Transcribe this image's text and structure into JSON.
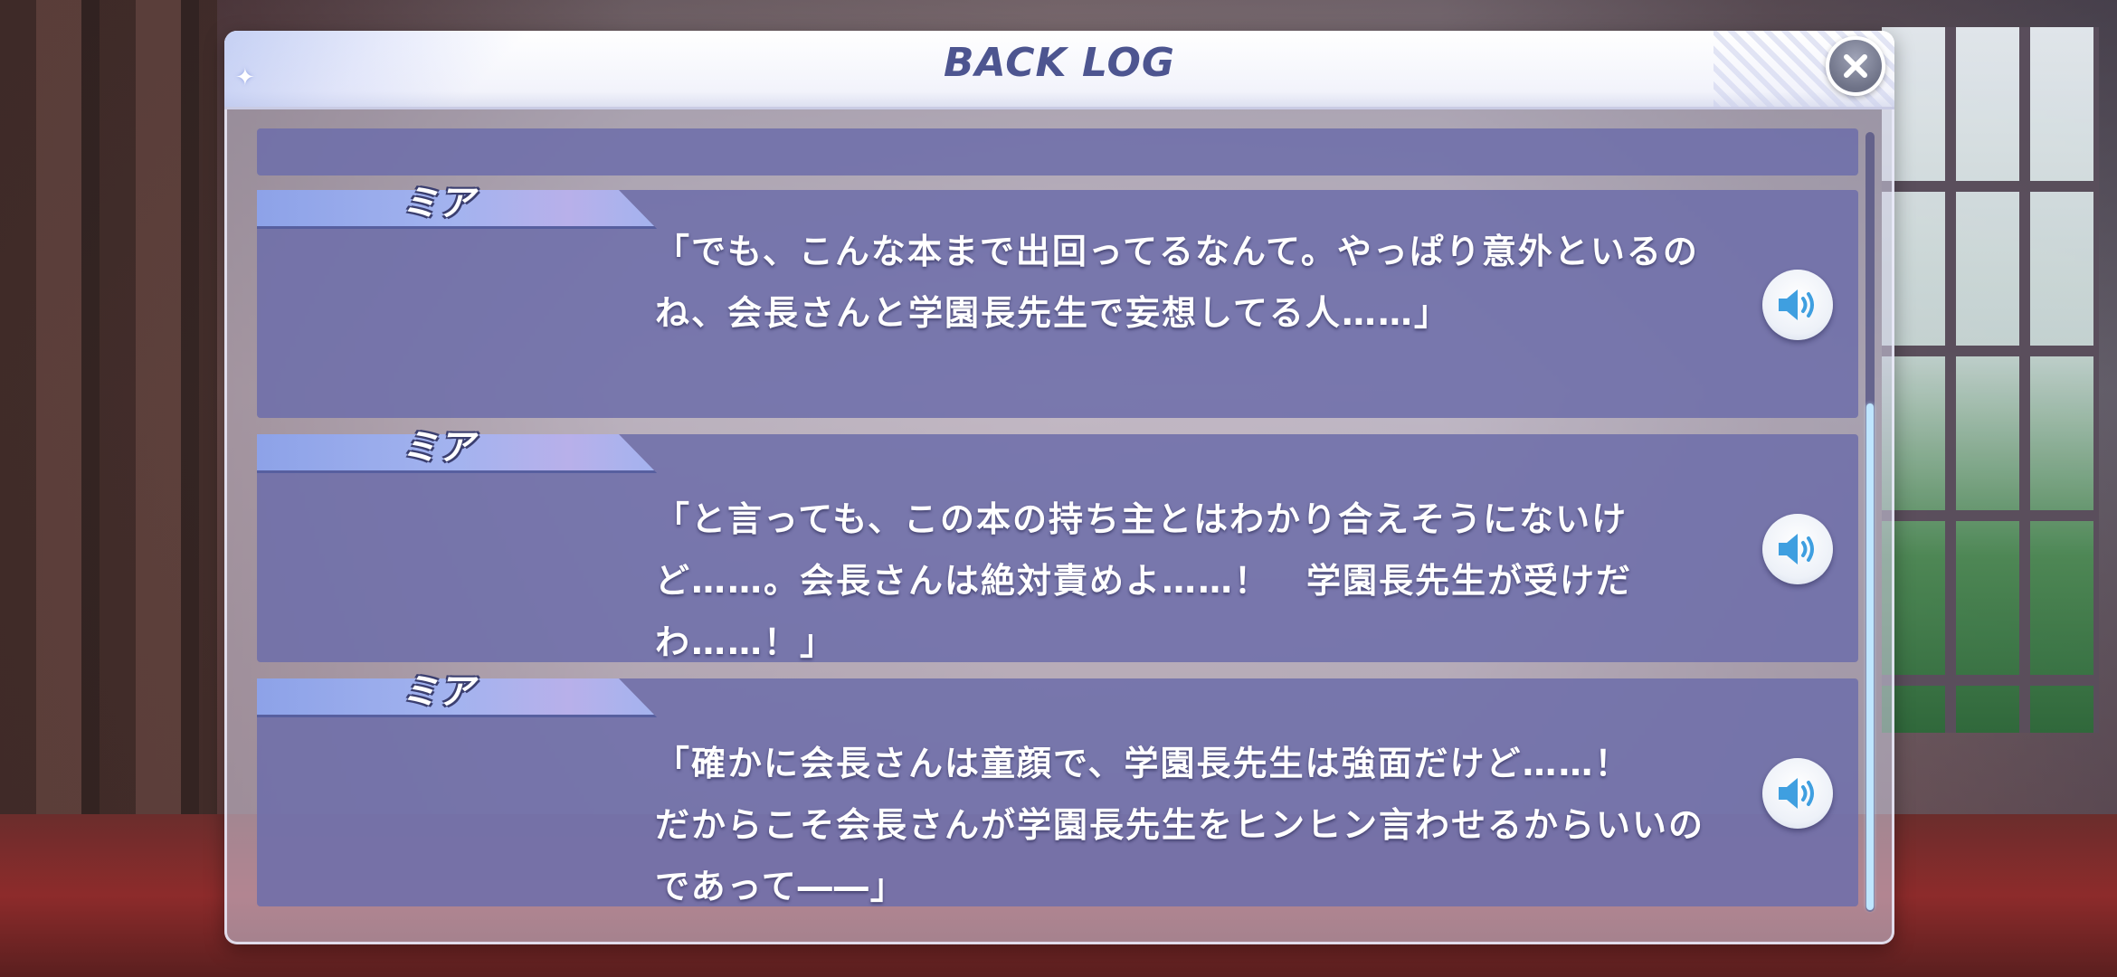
{
  "header": {
    "title": "BACK LOG",
    "close_icon": "close-icon",
    "sparkle_icon": "sparkle-icon"
  },
  "log": {
    "entries": [
      {
        "speaker": "ミア",
        "text": "「でも、こんな本まで出回ってるなんて。やっぱり意外といるのね、会長さんと学園長先生で妄想してる人……」",
        "voice_icon": "speaker-icon"
      },
      {
        "speaker": "ミア",
        "text": "「と言っても、この本の持ち主とはわかり合えそうにないけど……。会長さんは絶対責めよ……！　学園長先生が受けだわ……！」",
        "voice_icon": "speaker-icon"
      },
      {
        "speaker": "ミア",
        "text": "「確かに会長さんは童顔で、学園長先生は強面だけど……！\nだからこそ会長さんが学園長先生をヒンヒン言わせるからいいのであって――」",
        "voice_icon": "speaker-icon"
      }
    ]
  },
  "colors": {
    "title": "#4d5590",
    "entry_background": "#6e6eaa",
    "name_tab": "#a3b3ef",
    "scroll_thumb": "#bfe6ff"
  },
  "scroll": {
    "position": 0.35
  }
}
